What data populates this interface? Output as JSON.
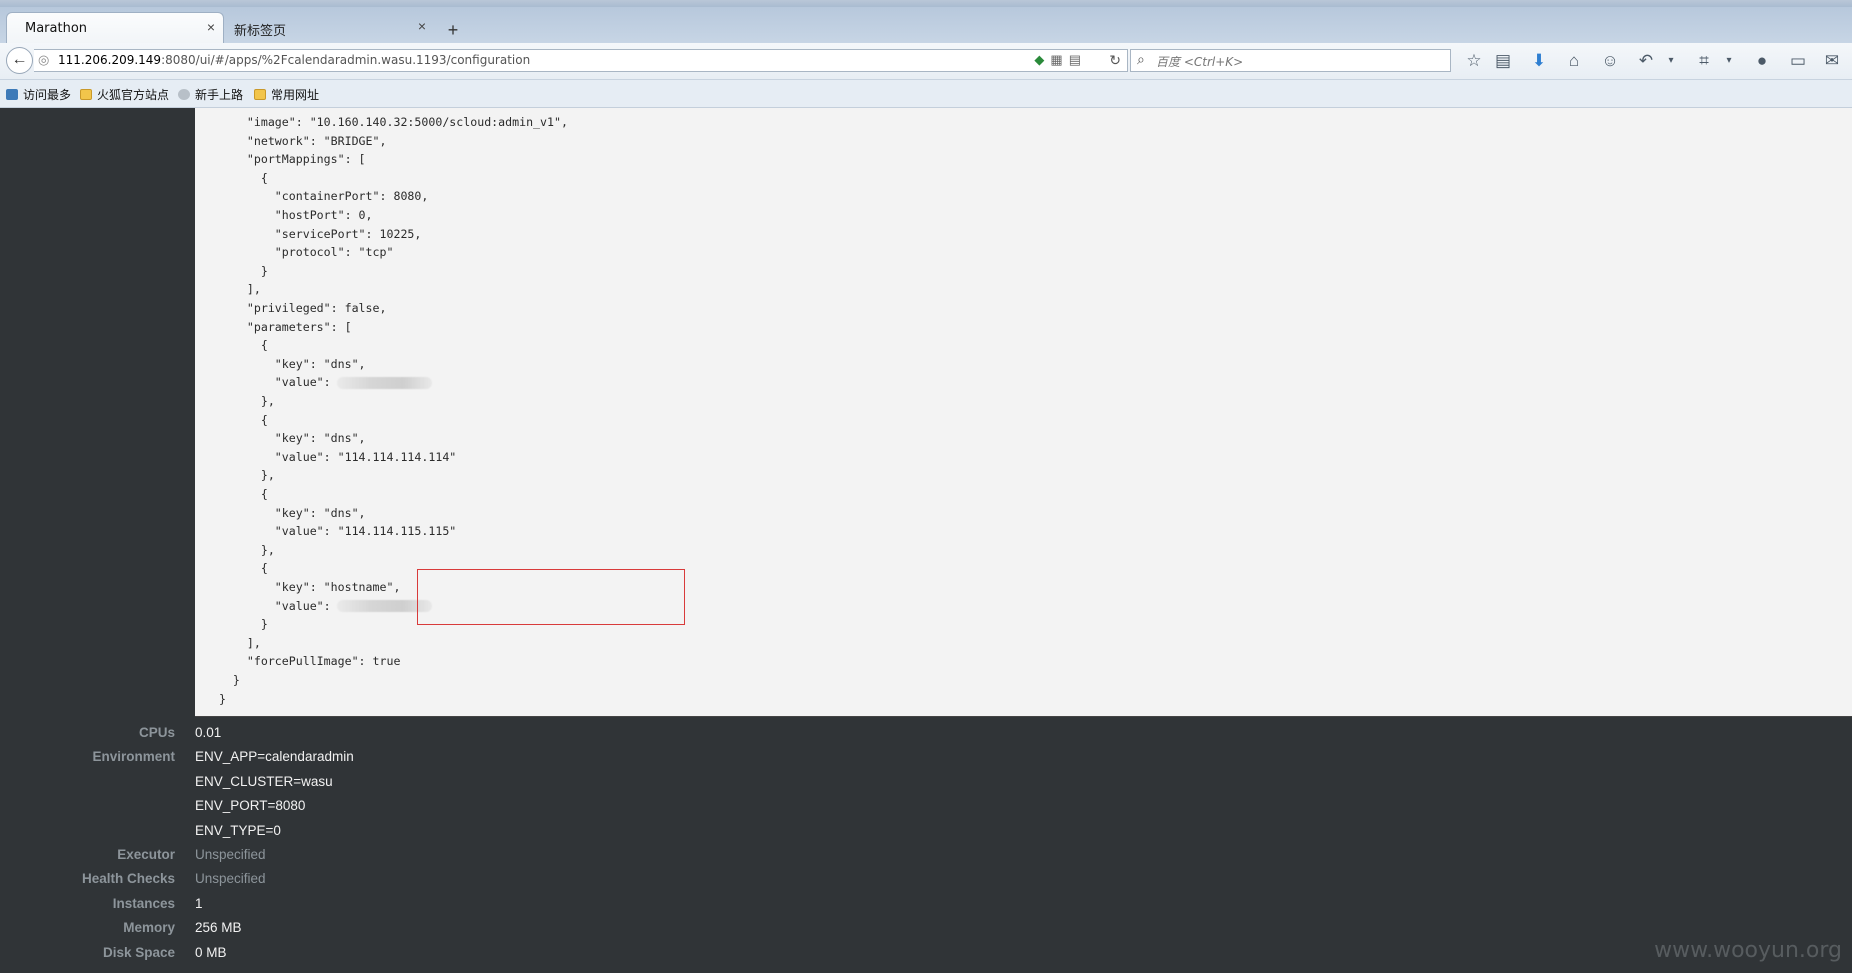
{
  "browser": {
    "tabs": [
      {
        "label": "Marathon",
        "close": "×"
      },
      {
        "label": "新标签页",
        "close": "×"
      }
    ],
    "new_tab": "+",
    "url": {
      "host": "111.206.209.149",
      "rest": ":8080/ui/#/apps/%2Fcalendaradmin.wasu.1193/configuration"
    },
    "search_placeholder": "百度 <Ctrl+K>",
    "bookmarks": [
      "访问最多",
      "火狐官方站点",
      "新手上路",
      "常用网址"
    ],
    "toolbar_icons": [
      "star-icon",
      "reading-list-icon",
      "download-icon",
      "home-icon",
      "chat-icon",
      "undo-icon",
      "crop-icon",
      "comment-icon",
      "screen-icon",
      "plugin-icon"
    ]
  },
  "json_config": {
    "lines": [
      "      \"image\": \"10.160.140.32:5000/scloud:admin_v1\",",
      "      \"network\": \"BRIDGE\",",
      "      \"portMappings\": [",
      "        {",
      "          \"containerPort\": 8080,",
      "          \"hostPort\": 0,",
      "          \"servicePort\": 10225,",
      "          \"protocol\": \"tcp\"",
      "        }",
      "      ],",
      "      \"privileged\": false,",
      "      \"parameters\": [",
      "        {",
      "          \"key\": \"dns\",",
      "          \"value\":",
      "        },",
      "        {",
      "          \"key\": \"dns\",",
      "          \"value\": \"114.114.114.114\"",
      "        },",
      "        {",
      "          \"key\": \"dns\",",
      "          \"value\": \"114.114.115.115\"",
      "        },",
      "        {",
      "          \"key\": \"hostname\",",
      "          \"value\":",
      "        }",
      "      ],",
      "      \"forcePullImage\": true",
      "    }",
      "  }"
    ],
    "redacted_lines": [
      14,
      26
    ]
  },
  "details": [
    {
      "label": "CPUs",
      "value": "0.01"
    },
    {
      "label": "Environment",
      "value": "ENV_APP=calendaradmin"
    },
    {
      "label": "",
      "value": "ENV_CLUSTER=wasu"
    },
    {
      "label": "",
      "value": "ENV_PORT=8080"
    },
    {
      "label": "",
      "value": "ENV_TYPE=0"
    },
    {
      "label": "Executor",
      "value": "Unspecified",
      "muted": true
    },
    {
      "label": "Health Checks",
      "value": "Unspecified",
      "muted": true
    },
    {
      "label": "Instances",
      "value": "1"
    },
    {
      "label": "Memory",
      "value": "256 MB"
    },
    {
      "label": "Disk Space",
      "value": "0 MB"
    }
  ],
  "watermark": "www.wooyun.org",
  "colors": {
    "highlight_border": "#d83a3a",
    "json_bg": "#f3f3f3",
    "page_bg": "#303437"
  }
}
